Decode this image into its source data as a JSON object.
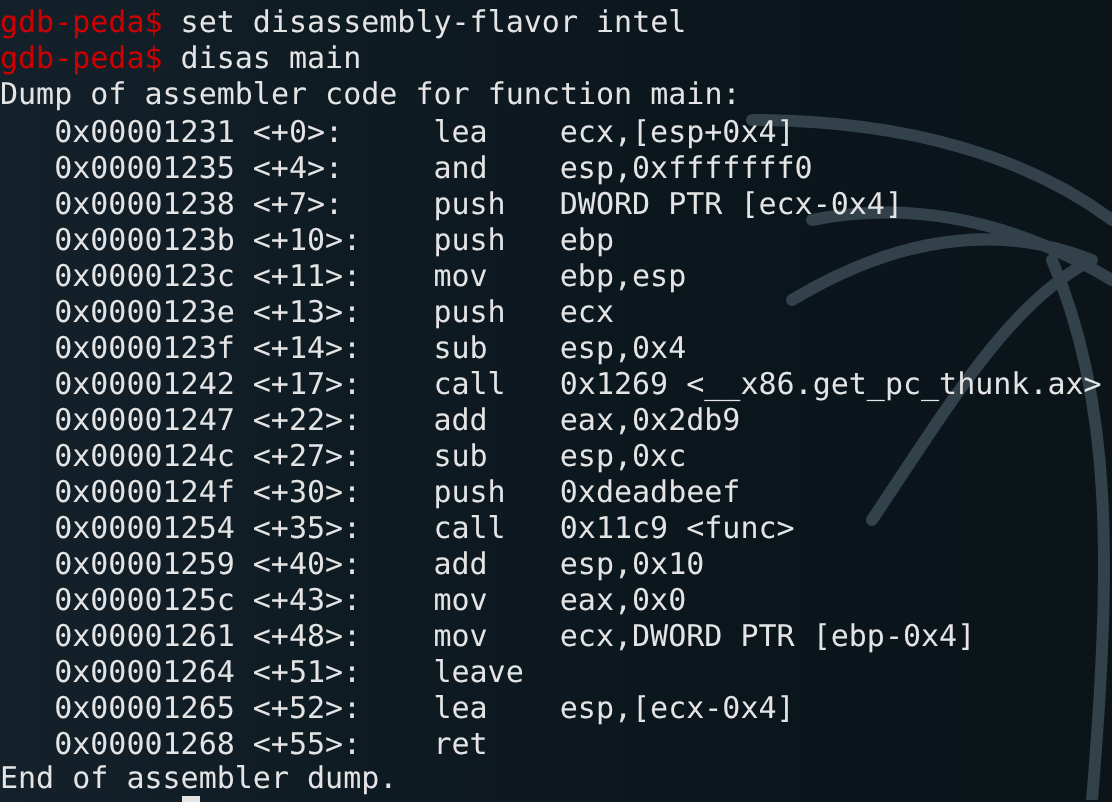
{
  "terminal": {
    "commands": [
      {
        "prompt": "gdb-peda$",
        "command": "set disassembly-flavor intel"
      },
      {
        "prompt": "gdb-peda$",
        "command": "disas main"
      }
    ],
    "header": "Dump of assembler code for function main:",
    "instructions": [
      {
        "address": "0x00001231",
        "offset": "<+0>:",
        "mnemonic": "lea",
        "operands": "ecx,[esp+0x4]"
      },
      {
        "address": "0x00001235",
        "offset": "<+4>:",
        "mnemonic": "and",
        "operands": "esp,0xfffffff0"
      },
      {
        "address": "0x00001238",
        "offset": "<+7>:",
        "mnemonic": "push",
        "operands": "DWORD PTR [ecx-0x4]"
      },
      {
        "address": "0x0000123b",
        "offset": "<+10>:",
        "mnemonic": "push",
        "operands": "ebp"
      },
      {
        "address": "0x0000123c",
        "offset": "<+11>:",
        "mnemonic": "mov",
        "operands": "ebp,esp"
      },
      {
        "address": "0x0000123e",
        "offset": "<+13>:",
        "mnemonic": "push",
        "operands": "ecx"
      },
      {
        "address": "0x0000123f",
        "offset": "<+14>:",
        "mnemonic": "sub",
        "operands": "esp,0x4"
      },
      {
        "address": "0x00001242",
        "offset": "<+17>:",
        "mnemonic": "call",
        "operands": "0x1269 <__x86.get_pc_thunk.ax>"
      },
      {
        "address": "0x00001247",
        "offset": "<+22>:",
        "mnemonic": "add",
        "operands": "eax,0x2db9"
      },
      {
        "address": "0x0000124c",
        "offset": "<+27>:",
        "mnemonic": "sub",
        "operands": "esp,0xc"
      },
      {
        "address": "0x0000124f",
        "offset": "<+30>:",
        "mnemonic": "push",
        "operands": "0xdeadbeef"
      },
      {
        "address": "0x00001254",
        "offset": "<+35>:",
        "mnemonic": "call",
        "operands": "0x11c9 <func>"
      },
      {
        "address": "0x00001259",
        "offset": "<+40>:",
        "mnemonic": "add",
        "operands": "esp,0x10"
      },
      {
        "address": "0x0000125c",
        "offset": "<+43>:",
        "mnemonic": "mov",
        "operands": "eax,0x0"
      },
      {
        "address": "0x00001261",
        "offset": "<+48>:",
        "mnemonic": "mov",
        "operands": "ecx,DWORD PTR [ebp-0x4]"
      },
      {
        "address": "0x00001264",
        "offset": "<+51>:",
        "mnemonic": "leave"
      },
      {
        "address": "0x00001265",
        "offset": "<+52>:",
        "mnemonic": "lea",
        "operands": "esp,[ecx-0x4]"
      },
      {
        "address": "0x00001268",
        "offset": "<+55>:",
        "mnemonic": "ret"
      }
    ],
    "footer": "End of assembler dump."
  }
}
